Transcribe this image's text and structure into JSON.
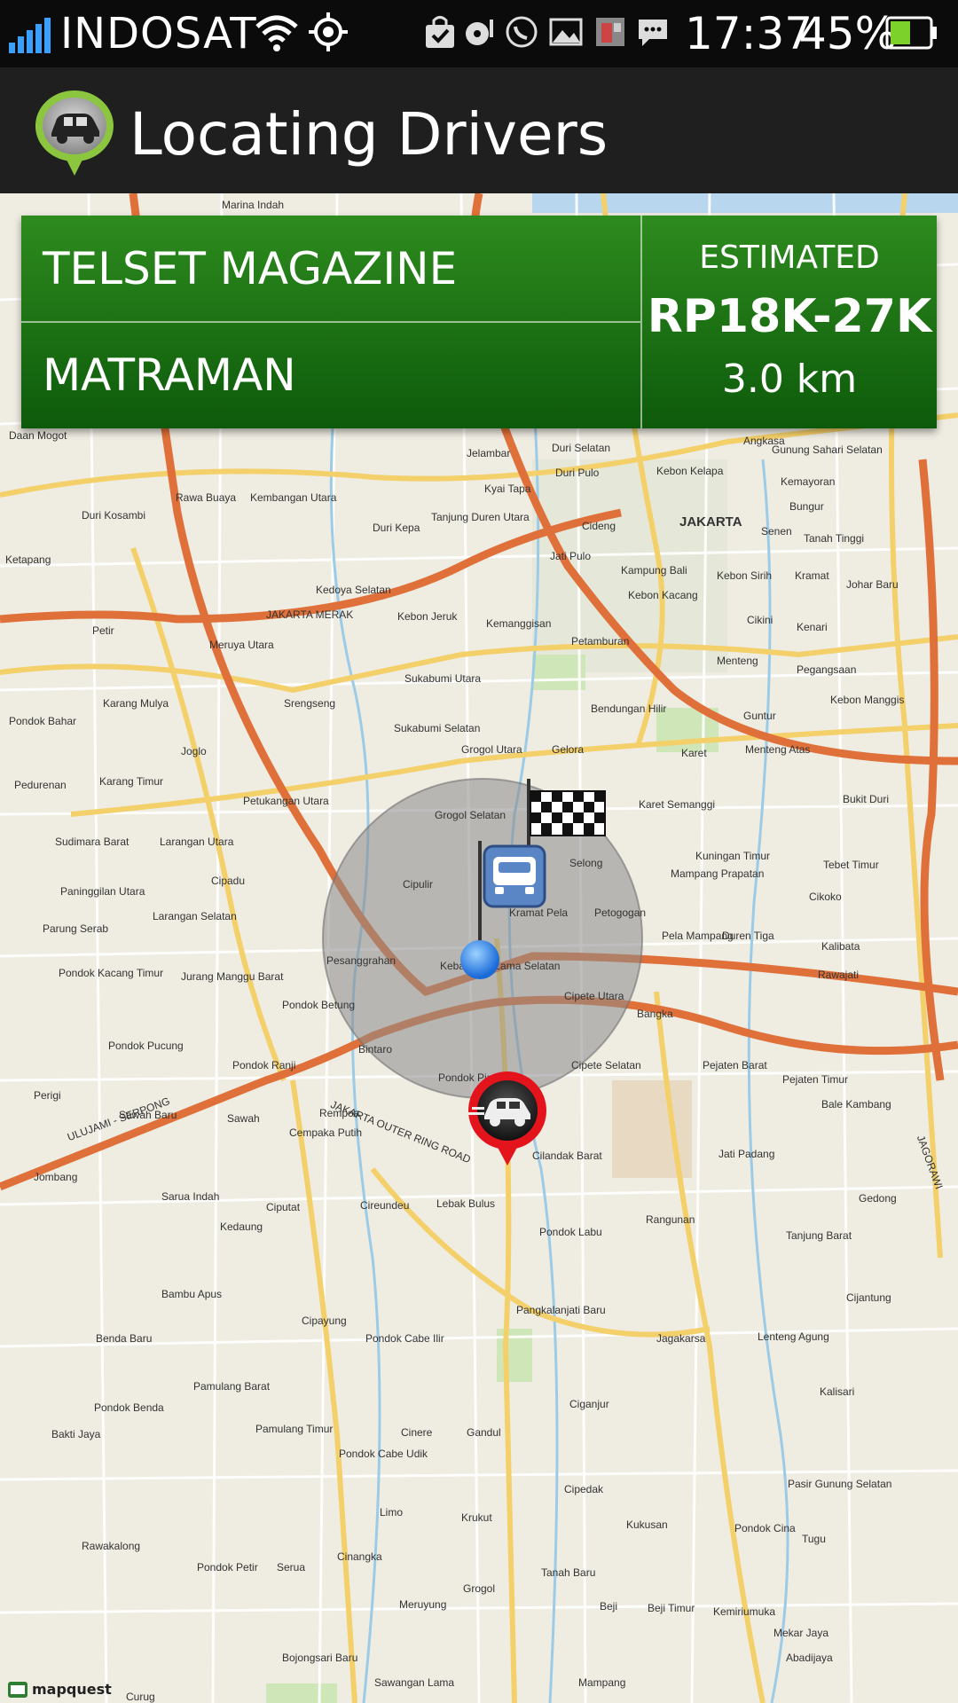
{
  "status_bar": {
    "carrier": "INDOSAT",
    "time": "17:37",
    "battery": "45%"
  },
  "app_bar": {
    "title": "Locating Drivers"
  },
  "trip": {
    "origin": "TELSET MAGAZINE",
    "destination": "MATRAMAN",
    "estimate_label": "ESTIMATED",
    "fare": "RP18K-27K",
    "distance": "3.0 km"
  },
  "map": {
    "attribution": "mapquest",
    "city_label": "JAKARTA",
    "roads": [
      "JAKARTA OUTER RING ROAD",
      "JAKARTA MERAK",
      "ULUJAMI - SERPONG",
      "JAGORAWI"
    ],
    "places": [
      "Marina Indah",
      "Daan Mogot",
      "Jelambar",
      "Duri Selatan",
      "Angkasa",
      "Gunung Sahari Selatan",
      "Rawa Buaya",
      "Kembangan Utara",
      "Kyai Tapa",
      "Duri Pulo",
      "Kebon Kelapa",
      "Kemayoran",
      "Duri Kosambi",
      "Tanjung Duren Utara",
      "Cideng",
      "Bungur",
      "Duri Kepa",
      "JAKARTA",
      "Senen",
      "Tanah Tinggi",
      "Ketapang",
      "Jati Pulo",
      "Kampung Bali",
      "Kebon Sirih",
      "Kramat",
      "Johar Baru",
      "Kedoya Selatan",
      "Kebon Kacang",
      "Cikini",
      "Kenari",
      "Petir",
      "Meruya Utara",
      "Kebon Jeruk",
      "Kemanggisan",
      "Petamburan",
      "Menteng",
      "Pegangsaan",
      "Sukabumi Utara",
      "Kebon Manggis",
      "Pondok Bahar",
      "Karang Mulya",
      "Srengseng",
      "Bendungan Hilir",
      "Guntur",
      "Sukabumi Selatan",
      "Joglo",
      "Grogol Utara",
      "Gelora",
      "Karet",
      "Menteng Atas",
      "Pedurenan",
      "Karang Timur",
      "Petukangan Utara",
      "Grogol Selatan",
      "Karet Semanggi",
      "Bukit Duri",
      "Sudimara Barat",
      "Larangan Utara",
      "Kuningan Timur",
      "Tebet Timur",
      "Cipadu",
      "Cipulir",
      "Selong",
      "Mampang Prapatan",
      "Paninggilan Utara",
      "Cikoko",
      "Larangan Selatan",
      "Kramat Pela",
      "Petogogan",
      "Parung Serab",
      "Pela Mampang",
      "Duren Tiga",
      "Kalibata",
      "Pesanggrahan",
      "Kebayoran Lama Selatan",
      "Pondok Kacang Timur",
      "Jurang Manggu Barat",
      "Rawajati",
      "Pondok Betung",
      "Cipete Utara",
      "Bangka",
      "Pondok Pucung",
      "Bintaro",
      "Cipete Selatan",
      "Pejaten Barat",
      "Pejaten Timur",
      "Pondok Ranji",
      "Pondok Pinang",
      "Perigi",
      "Rempoa",
      "Bale Kambang",
      "Sawah Baru",
      "Sawah",
      "Cempaka Putih",
      "Cilandak Barat",
      "Jati Padang",
      "Jombang",
      "Sarua Indah",
      "Ciputat",
      "Cireundeu",
      "Lebak Bulus",
      "Rangunan",
      "Gedong",
      "Kedaung",
      "Pondok Labu",
      "Tanjung Barat",
      "Bambu Apus",
      "Cijantung",
      "Cipayung",
      "Pangkalanjati Baru",
      "Benda Baru",
      "Pondok Cabe Ilir",
      "Jagakarsa",
      "Lenteng Agung",
      "Pamulang Barat",
      "Pondok Benda",
      "Kalisari",
      "Bakti Jaya",
      "Pamulang Timur",
      "Cinere",
      "Gandul",
      "Ciganjur",
      "Pasir Gunung Selatan",
      "Pondok Cabe Udik",
      "Cipedak",
      "Limo",
      "Krukut",
      "Kukusan",
      "Rawakalong",
      "Pondok Cina",
      "Tugu",
      "Pondok Petir",
      "Serua",
      "Cinangka",
      "Tanah Baru",
      "Meruyung",
      "Grogol",
      "Beji",
      "Beji Timur",
      "Kemiriumuka",
      "Mekar Jaya",
      "Abadijaya",
      "Bojongsari Baru",
      "Sawangan Lama",
      "Mampang",
      "Curug"
    ]
  },
  "colors": {
    "status_bar": "#0b0b0b",
    "app_bar": "#1f1f1f",
    "trip_panel_top": "#2e8b1e",
    "trip_panel_bottom": "#0d5a0b",
    "road_major": "#e0703a",
    "road_minor": "#f4d06a",
    "map_background": "#efece2",
    "search_radius": "#8a8a8a",
    "driver_marker": "#e3141b"
  },
  "icons": {
    "signal": "signal-icon",
    "wifi": "wifi-icon",
    "gps": "gps-icon",
    "app_logo": "taxi-logo-icon",
    "user_pin": "user-location-pin-icon",
    "destination_flag": "checkered-flag-icon",
    "taxi_marker": "taxi-marker-icon",
    "driver_marker": "driver-car-marker-icon"
  }
}
